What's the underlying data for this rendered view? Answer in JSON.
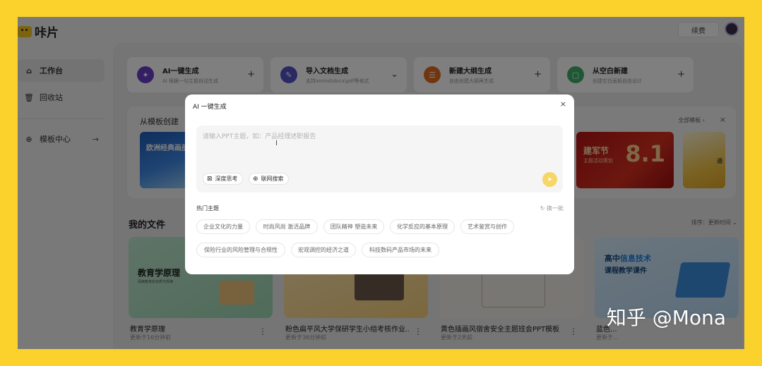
{
  "app": {
    "logo_text": "咔片",
    "login_label": "续费"
  },
  "sidebar": {
    "items": [
      {
        "label": "工作台",
        "icon": "home-icon"
      },
      {
        "label": "回收站",
        "icon": "trash-icon"
      },
      {
        "label": "模板中心",
        "icon": "globe-icon",
        "arrow": "→"
      }
    ]
  },
  "create_cards": [
    {
      "title": "AI一键生成",
      "subtitle": "AI 根据一句主题自动生成",
      "plus": "+",
      "color": "#6a3ec9",
      "icon": "magic-wand-icon"
    },
    {
      "title": "导入文档生成",
      "subtitle": "支持xmind\\docx\\pdf等格式",
      "plus": "⌄",
      "color": "#5553c9",
      "icon": "document-icon"
    },
    {
      "title": "新建大纲生成",
      "subtitle": "自由创建大纲再生成",
      "plus": "+",
      "color": "#e36d1e",
      "icon": "outline-icon"
    },
    {
      "title": "从空白新建",
      "subtitle": "创建空白画板自由设计",
      "plus": "+",
      "color": "#3fae69",
      "icon": "blank-page-icon"
    }
  ],
  "templates": {
    "title": "从模板创建",
    "all_label": "全部模板 ›",
    "close": "×",
    "thumb_a": "欧洲经典画册",
    "thumb_b": {
      "title": "建军节",
      "subtitle": "主题活动策划",
      "number": "8.1"
    },
    "thumb_c": "通"
  },
  "files": {
    "title": "我的文件",
    "sort_label": "排序：更新时间 ⌄",
    "items": [
      {
        "name": "教育学原理",
        "time": "更新于16分钟前",
        "cover_title": "教育学原理",
        "cover_subtitle": "探索教育的本质与规律"
      },
      {
        "name": "粉色扁平风大学保研学生小组考核作业...",
        "time": "更新于36分钟前"
      },
      {
        "name": "黄色插画风宿舍安全主题班会PPT模板",
        "time": "更新于2天前"
      },
      {
        "name": "蓝色...",
        "time": "更新于...",
        "cover_title_a": "高中",
        "cover_title_b": "信息技术",
        "cover_title_c": "课程教学课件"
      }
    ],
    "more": "⋮"
  },
  "modal": {
    "title": "AI 一键生成",
    "close": "×",
    "prompt_placeholder": "请输入PPT主题，如：产品经理述职报告",
    "chip_deep": "深度思考",
    "chip_web": "联网搜索",
    "send": "➤",
    "hot_title": "热门主题",
    "refresh_label": "换一批",
    "tags": [
      "企业文化的力量",
      "时尚风尚 激活品牌",
      "团队精神 塑造未来",
      "化学反应的基本原理",
      "艺术鉴赏与创作",
      "保险行业的风险管理与合规性",
      "宏观调控的经济之道",
      "科技数码产品市场的未来"
    ]
  },
  "watermark": "知乎 @Mona"
}
